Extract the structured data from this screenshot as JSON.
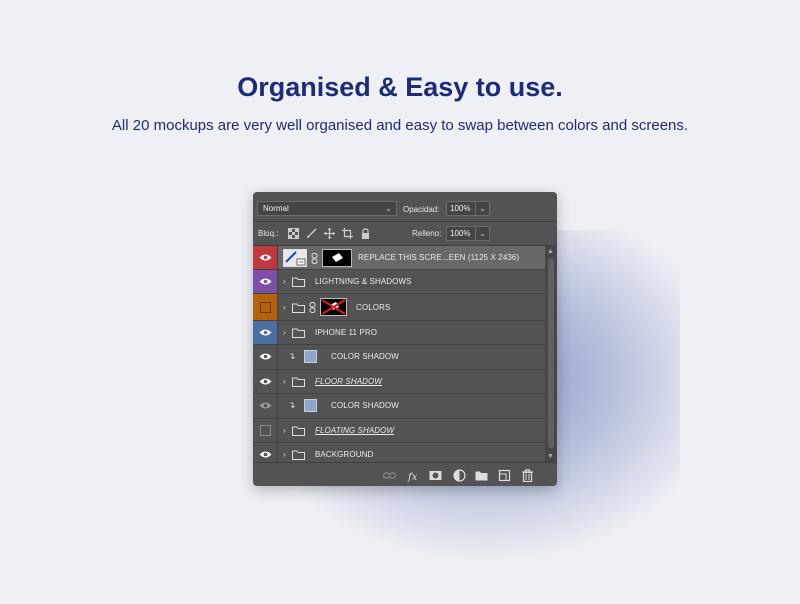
{
  "header": {
    "title": "Organised & Easy to use.",
    "subtitle": "All 20 mockups are very well organised and easy to swap between colors and screens."
  },
  "panel": {
    "blend_mode": "Normal",
    "opacity_label": "Opacidad:",
    "opacity_value": "100%",
    "lock_label": "Bloq.:",
    "fill_label": "Relleno:",
    "fill_value": "100%",
    "layers": [
      {
        "name": "REPLACE THIS SCRE...EEN (1125 X 2436)",
        "visible": true,
        "tag_color": "#c0393f",
        "selected": true,
        "kind": "smart-object"
      },
      {
        "name": "LIGHTNING & SHADOWS",
        "visible": true,
        "tag_color": "#7d4fa8",
        "kind": "group"
      },
      {
        "name": "COLORS",
        "visible": false,
        "tag_color": "#b5620f",
        "kind": "group-masked"
      },
      {
        "name": "IPHONE 11 PRO",
        "visible": true,
        "tag_color": "#4a6fa5",
        "kind": "group"
      },
      {
        "name": "COLOR SHADOW",
        "visible": true,
        "tag_color": "",
        "kind": "clipped-fill"
      },
      {
        "name": "FLOOR SHADOW",
        "visible": true,
        "tag_color": "",
        "kind": "group-underlined"
      },
      {
        "name": "COLOR SHADOW",
        "visible": true,
        "tag_color": "",
        "kind": "clipped-fill-dim"
      },
      {
        "name": "FLOATING SHADOW",
        "visible": false,
        "tag_color": "",
        "kind": "group-underlined"
      },
      {
        "name": "BACKGROUND",
        "visible": true,
        "tag_color": "",
        "kind": "group"
      }
    ],
    "bottom_icons": [
      "link-icon",
      "fx-icon",
      "mask-icon",
      "adjustment-icon",
      "folder-icon",
      "new-layer-icon",
      "trash-icon"
    ]
  }
}
